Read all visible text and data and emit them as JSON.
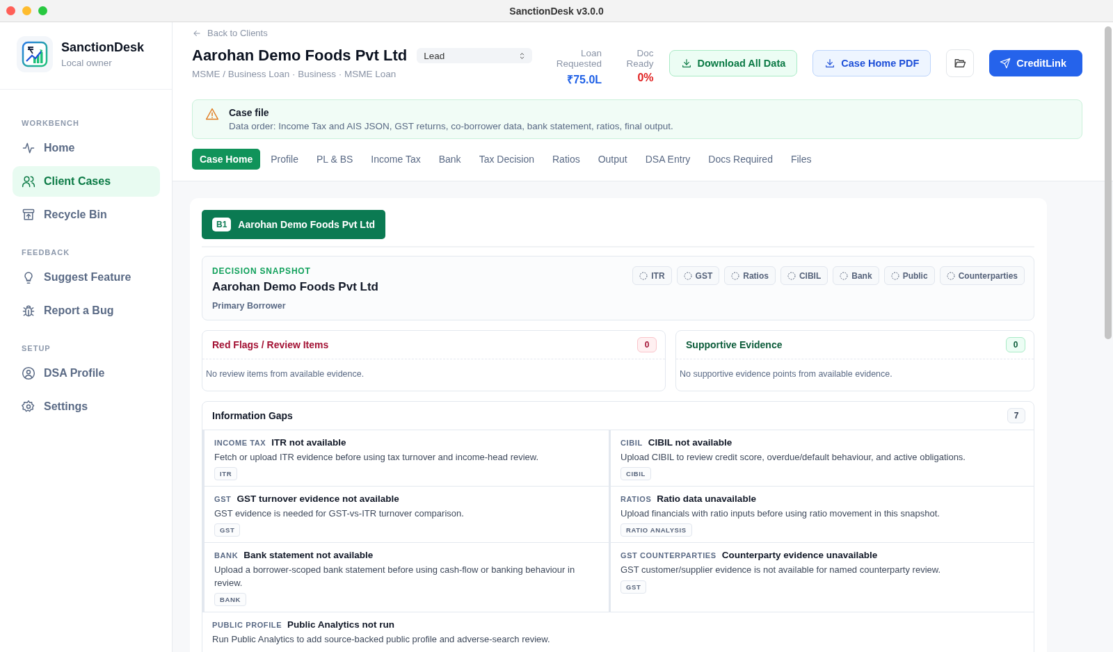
{
  "window": {
    "title": "SanctionDesk v3.0.0"
  },
  "sidebar": {
    "app_name": "SanctionDesk",
    "subtitle": "Local owner",
    "sections": [
      {
        "heading": "WORKBENCH",
        "items": [
          {
            "label": "Home",
            "selected": false
          },
          {
            "label": "Client Cases",
            "selected": true
          },
          {
            "label": "Recycle Bin",
            "selected": false
          }
        ]
      },
      {
        "heading": "FEEDBACK",
        "items": [
          {
            "label": "Suggest Feature",
            "selected": false
          },
          {
            "label": "Report a Bug",
            "selected": false
          }
        ]
      },
      {
        "heading": "SETUP",
        "items": [
          {
            "label": "DSA Profile",
            "selected": false
          },
          {
            "label": "Settings",
            "selected": false
          }
        ]
      }
    ]
  },
  "header": {
    "back_link": "Back to Clients",
    "title": "Aarohan Demo Foods Pvt Ltd",
    "status": "Lead",
    "subtitle": "MSME / Business Loan · Business · MSME Loan",
    "metrics": [
      {
        "label": "Loan Requested",
        "value": "₹75.0L",
        "color": "#1d5fe6"
      },
      {
        "label": "Doc Ready",
        "value": "0%",
        "color": "#e01e1e"
      }
    ],
    "buttons": [
      {
        "kind": "success",
        "label": "Download All Data"
      },
      {
        "kind": "light",
        "label": "Case Home PDF"
      },
      {
        "kind": "icon"
      },
      {
        "kind": "primary",
        "label": "CreditLink"
      }
    ]
  },
  "alert": {
    "title": "Case file",
    "text": "Data order: Income Tax and AIS JSON, GST returns, co-borrower data, bank statement, ratios, final output."
  },
  "tabs": [
    {
      "label": "Case Home",
      "selected": true
    },
    {
      "label": "Profile",
      "selected": false
    },
    {
      "label": "PL & BS",
      "selected": false
    },
    {
      "label": "Income Tax",
      "selected": false
    },
    {
      "label": "Bank",
      "selected": false
    },
    {
      "label": "Tax Decision",
      "selected": false
    },
    {
      "label": "Ratios",
      "selected": false
    },
    {
      "label": "Output",
      "selected": false
    },
    {
      "label": "DSA Entry",
      "selected": false
    },
    {
      "label": "Docs Required",
      "selected": false
    },
    {
      "label": "Files",
      "selected": false
    }
  ],
  "borrower_tab": {
    "badge": "B1",
    "name": "Aarohan Demo Foods Pvt Ltd"
  },
  "snapshot": {
    "eyebrow": "DECISION SNAPSHOT",
    "name": "Aarohan Demo Foods Pvt Ltd",
    "role": "Primary Borrower",
    "chips": [
      "ITR",
      "GST",
      "Ratios",
      "CIBIL",
      "Bank",
      "Public",
      "Counterparties"
    ]
  },
  "panels": [
    {
      "kind": "risk",
      "title": "Red Flags / Review Items",
      "count": "0",
      "empty_text": "No review items from available evidence."
    },
    {
      "kind": "support",
      "title": "Supportive Evidence",
      "count": "0",
      "empty_text": "No supportive evidence points from available evidence."
    }
  ],
  "info_gaps": {
    "title": "Information Gaps",
    "count": "7",
    "items": [
      {
        "category": "INCOME TAX",
        "title": "ITR not available",
        "text": "Fetch or upload ITR evidence before using tax turnover and income-head review.",
        "tags": [
          "ITR"
        ]
      },
      {
        "category": "CIBIL",
        "title": "CIBIL not available",
        "text": "Upload CIBIL to review credit score, overdue/default behaviour, and active obligations.",
        "tags": [
          "CIBIL"
        ]
      },
      {
        "category": "GST",
        "title": "GST turnover evidence not available",
        "text": "GST evidence is needed for GST-vs-ITR turnover comparison.",
        "tags": [
          "GST"
        ]
      },
      {
        "category": "RATIOS",
        "title": "Ratio data unavailable",
        "text": "Upload financials with ratio inputs before using ratio movement in this snapshot.",
        "tags": [
          "RATIO ANALYSIS"
        ]
      },
      {
        "category": "BANK",
        "title": "Bank statement not available",
        "text": "Upload a borrower-scoped bank statement before using cash-flow or banking behaviour in review.",
        "tags": [
          "BANK"
        ]
      },
      {
        "category": "GST COUNTERPARTIES",
        "title": "Counterparty evidence unavailable",
        "text": "GST customer/supplier evidence is not available for named counterparty review.",
        "tags": [
          "GST"
        ]
      },
      {
        "category": "PUBLIC PROFILE",
        "title": "Public Analytics not run",
        "text": "Run Public Analytics to add source-backed public profile and adverse-search review."
      }
    ]
  }
}
